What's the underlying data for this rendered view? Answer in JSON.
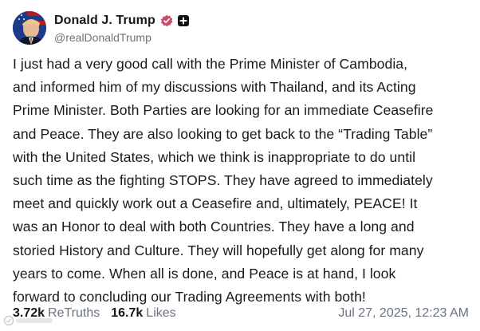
{
  "author": {
    "display_name": "Donald J. Trump",
    "handle": "@realDonaldTrump"
  },
  "post": {
    "lines": [
      "I just had a very good call with the Prime Minister of Cambodia,",
      "and informed him of my discussions with Thailand, and its Acting",
      "Prime Minister. Both Parties are looking for an immediate Ceasefire",
      "and Peace. They are also looking to get back to the “Trading Table”",
      "with the United States, which we think is inappropriate to do until",
      "such time as the fighting STOPS. They have agreed to immediately",
      "meet and quickly work out a Ceasefire and, ultimately, PEACE! It",
      "was an Honor to deal with both Countries. They have a long and",
      "storied History and Culture. They will hopefully get along for many",
      "years to come. When all is done, and Peace is at hand, I look",
      "forward to concluding our Trading Agreements with both!"
    ]
  },
  "footer": {
    "retruths_count": "3.72k",
    "retruths_label": "ReTruths",
    "likes_count": "16.7k",
    "likes_label": "Likes",
    "timestamp": "Jul 27, 2025, 12:23 AM"
  },
  "icons": {
    "verified": "verified-badge-icon",
    "plus": "plus-square-icon"
  },
  "colors": {
    "verified_badge": "#c84b6b",
    "text": "#1a1a1a",
    "muted": "#6b7280"
  }
}
